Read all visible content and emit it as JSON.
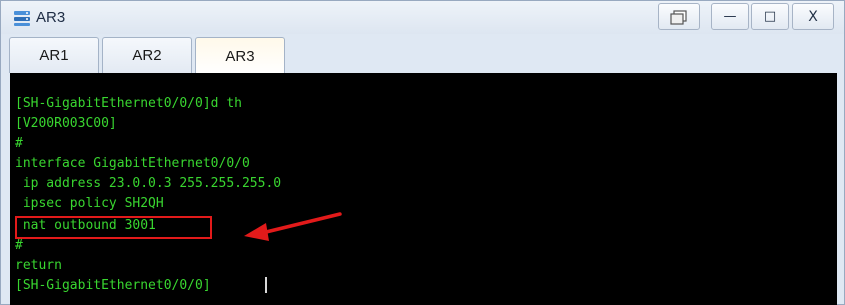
{
  "window": {
    "title": "AR3",
    "controls": {
      "restore": "⧉",
      "minimize": "—",
      "maximize": "□",
      "close": "X"
    }
  },
  "tabs": [
    {
      "label": "AR1",
      "active": false
    },
    {
      "label": "AR2",
      "active": false
    },
    {
      "label": "AR3",
      "active": true
    }
  ],
  "terminal": {
    "lines": [
      "[SH-GigabitEthernet0/0/0]d th",
      "[V200R003C00]",
      "#",
      "interface GigabitEthernet0/0/0",
      " ip address 23.0.0.3 255.255.255.0",
      " ipsec policy SH2QH",
      " nat outbound 3001",
      "#",
      "return",
      "[SH-GigabitEthernet0/0/0]"
    ],
    "highlighted_line_index": 6,
    "text_color": "#39d630",
    "background": "#000000",
    "annotation_color": "#e21a1a"
  }
}
